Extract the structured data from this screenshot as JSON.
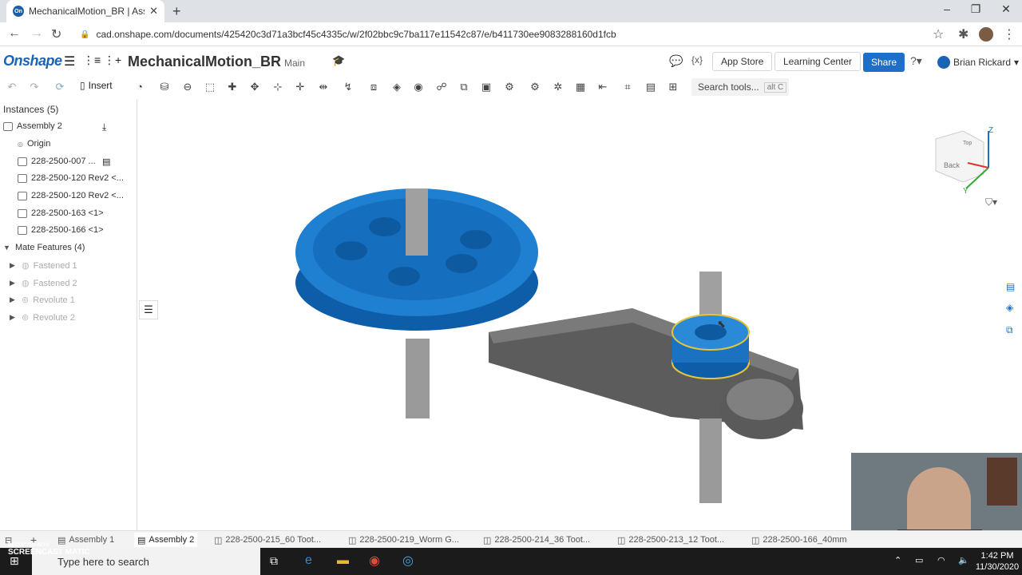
{
  "browser": {
    "tab_title": "MechanicalMotion_BR | Assembl",
    "tab_favicon": "On",
    "url": "cad.onshape.com/documents/425420c3d71a3bcf45c4335c/w/2f02bbc9c7ba117e11542c87/e/b411730ee9083288160d1fcb"
  },
  "header": {
    "logo": "Onshape",
    "doc_name": "MechanicalMotion_BR",
    "branch": "Main",
    "app_store": "App Store",
    "learning_center": "Learning Center",
    "share": "Share",
    "user_name": "Brian Rickard"
  },
  "toolbar": {
    "insert": "Insert",
    "search_tools": "Search tools...",
    "search_shortcut": "alt C"
  },
  "panel": {
    "instances_header": "Instances (5)",
    "assembly": "Assembly 2",
    "instances": [
      "Origin",
      "228-2500-007 ...",
      "228-2500-120 Rev2 <...",
      "228-2500-120 Rev2 <...",
      "228-2500-163 <1>",
      "228-2500-166 <1>"
    ],
    "mates_header": "Mate Features (4)",
    "mates": [
      "Fastened 1",
      "Fastened 2",
      "Revolute 1",
      "Revolute 2"
    ]
  },
  "view_cube": {
    "top_label": "Top",
    "side_label": "Back",
    "axis_z": "Z",
    "axis_y": "Y"
  },
  "bottom_tabs": [
    "Assembly 1",
    "Assembly 2",
    "228-2500-215_60 Toot...",
    "228-2500-219_Worm G...",
    "228-2500-214_36 Toot...",
    "228-2500-213_12 Toot...",
    "228-2500-166_40mm"
  ],
  "taskbar": {
    "search_placeholder": "Type here to search",
    "time": "1:42 PM",
    "date": "11/30/2020",
    "watermark_top": "RECORDED WITH",
    "watermark": "SCREENCAST MATIC"
  },
  "colors": {
    "accent": "#1f6fc9",
    "part_blue": "#1f7fd0",
    "part_gray": "#6a6a6a"
  }
}
